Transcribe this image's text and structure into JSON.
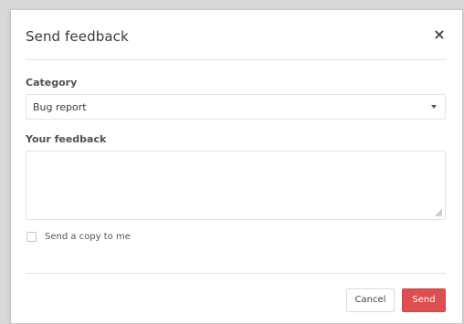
{
  "dialog": {
    "title": "Send feedback",
    "close_label": "×"
  },
  "category": {
    "label": "Category",
    "selected": "Bug report"
  },
  "feedback": {
    "label": "Your feedback",
    "value": "",
    "placeholder": ""
  },
  "copy_to_me": {
    "label": "Send a copy to me",
    "checked": false
  },
  "buttons": {
    "cancel": "Cancel",
    "send": "Send"
  },
  "colors": {
    "send_button": "#dc4e4f",
    "backdrop": "#d9d9d9"
  }
}
